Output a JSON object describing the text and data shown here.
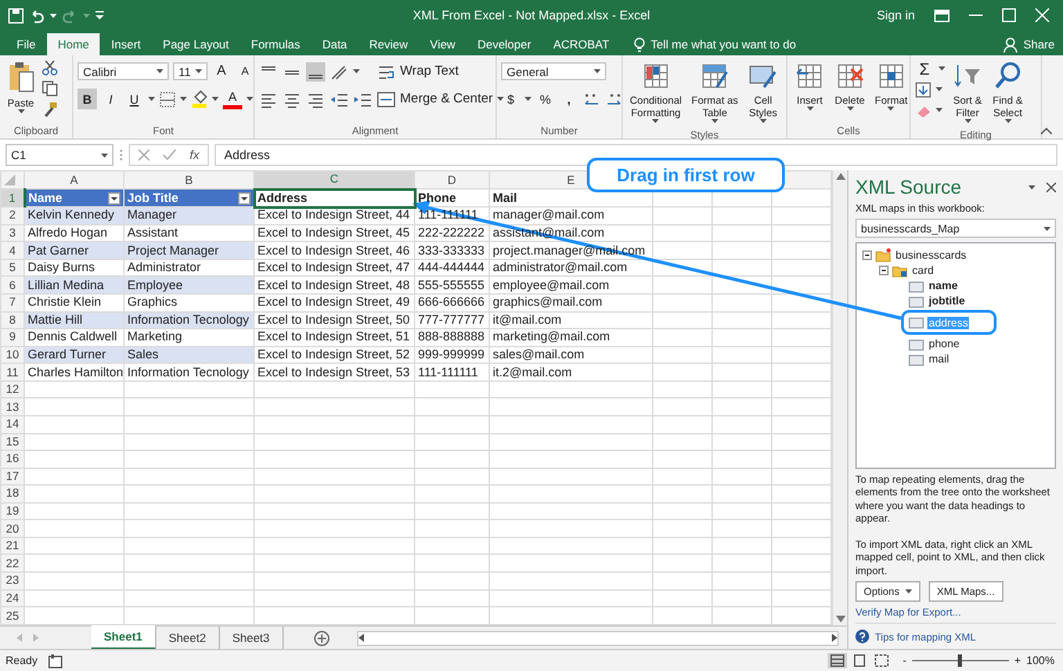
{
  "title_bar": {
    "title": "XML From Excel - Not Mapped.xlsx - Excel",
    "sign_in": "Sign in"
  },
  "tabs": [
    {
      "label": "File",
      "selected": false
    },
    {
      "label": "Home",
      "selected": true
    },
    {
      "label": "Insert",
      "selected": false
    },
    {
      "label": "Page Layout",
      "selected": false
    },
    {
      "label": "Formulas",
      "selected": false
    },
    {
      "label": "Data",
      "selected": false
    },
    {
      "label": "Review",
      "selected": false
    },
    {
      "label": "View",
      "selected": false
    },
    {
      "label": "Developer",
      "selected": false
    },
    {
      "label": "ACROBAT",
      "selected": false
    }
  ],
  "tell_me": "Tell me what you want to do",
  "share": "Share",
  "ribbon": {
    "clipboard": {
      "paste": "Paste",
      "label": "Clipboard"
    },
    "font": {
      "family": "Calibri",
      "size": "11",
      "grow": "A",
      "shrink": "A",
      "bold": {
        "text": "B",
        "on": true
      },
      "italic": {
        "text": "I",
        "on": false
      },
      "underline": {
        "text": "U",
        "on": false
      },
      "color_button": "A",
      "label": "Font"
    },
    "alignment": {
      "align_bottom": {
        "on": true
      },
      "wrap": "Wrap Text",
      "merge": "Merge & Center",
      "label": "Alignment"
    },
    "number": {
      "format": "General",
      "currency": "$",
      "percent": "%",
      "comma": ",",
      "label": "Number"
    },
    "styles": {
      "buttons": [
        {
          "lines": [
            "Conditional",
            "Formatting"
          ]
        },
        {
          "lines": [
            "Format as",
            "Table"
          ]
        },
        {
          "lines": [
            "Cell",
            "Styles"
          ]
        }
      ],
      "label": "Styles"
    },
    "cells": {
      "buttons": [
        "Insert",
        "Delete",
        "Format"
      ],
      "label": "Cells"
    },
    "editing": {
      "sum": "Σ",
      "sort": [
        "Sort &",
        "Filter"
      ],
      "find": [
        "Find &",
        "Select"
      ],
      "label": "Editing"
    }
  },
  "formula_bar": {
    "name_box": "C1",
    "fx": "fx",
    "content": "Address"
  },
  "sheet": {
    "columns": [
      {
        "letter": "A",
        "selected": false,
        "in_table": true
      },
      {
        "letter": "B",
        "selected": false,
        "in_table": true
      },
      {
        "letter": "C",
        "selected": true,
        "in_table": false
      },
      {
        "letter": "D",
        "selected": false,
        "in_table": false
      },
      {
        "letter": "E",
        "selected": false,
        "in_table": false
      }
    ],
    "rows": [
      {
        "number": "1",
        "kind": "header",
        "selected": true,
        "cells": [
          "Name",
          "Job Title",
          "Address",
          "Phone",
          "Mail"
        ]
      },
      {
        "number": "2",
        "kind": "data",
        "selected": false,
        "cells": [
          "Kelvin Kennedy",
          "Manager",
          "Excel to Indesign Street, 44",
          "111-111111",
          "manager@mail.com"
        ]
      },
      {
        "number": "3",
        "kind": "data",
        "selected": false,
        "cells": [
          "Alfredo Hogan",
          "Assistant",
          "Excel to Indesign Street, 45",
          "222-222222",
          "assistant@mail.com"
        ]
      },
      {
        "number": "4",
        "kind": "data",
        "selected": false,
        "cells": [
          "Pat Garner",
          "Project Manager",
          "Excel to Indesign Street, 46",
          "333-333333",
          "project.manager@mail.com"
        ]
      },
      {
        "number": "5",
        "kind": "data",
        "selected": false,
        "cells": [
          "Daisy Burns",
          "Administrator",
          "Excel to Indesign Street, 47",
          "444-444444",
          "administrator@mail.com"
        ]
      },
      {
        "number": "6",
        "kind": "data",
        "selected": false,
        "cells": [
          "Lillian Medina",
          "Employee",
          "Excel to Indesign Street, 48",
          "555-555555",
          "employee@mail.com"
        ]
      },
      {
        "number": "7",
        "kind": "data",
        "selected": false,
        "cells": [
          "Christie Klein",
          "Graphics",
          "Excel to Indesign Street, 49",
          "666-666666",
          "graphics@mail.com"
        ]
      },
      {
        "number": "8",
        "kind": "data",
        "selected": false,
        "cells": [
          "Mattie Hill",
          "Information Tecnology",
          "Excel to Indesign Street, 50",
          "777-777777",
          "it@mail.com"
        ]
      },
      {
        "number": "9",
        "kind": "data",
        "selected": false,
        "cells": [
          "Dennis Caldwell",
          "Marketing",
          "Excel to Indesign Street, 51",
          "888-888888",
          "marketing@mail.com"
        ]
      },
      {
        "number": "10",
        "kind": "data",
        "selected": false,
        "cells": [
          "Gerard Turner",
          "Sales",
          "Excel to Indesign Street, 52",
          "999-999999",
          "sales@mail.com"
        ]
      },
      {
        "number": "11",
        "kind": "data",
        "selected": false,
        "cells": [
          "Charles Hamilton",
          "Information Tecnology",
          "Excel to Indesign Street, 53",
          "111-111111",
          "it.2@mail.com"
        ]
      },
      {
        "number": "12",
        "kind": "data",
        "selected": false,
        "cells": []
      },
      {
        "number": "13",
        "kind": "data",
        "selected": false,
        "cells": []
      },
      {
        "number": "14",
        "kind": "data",
        "selected": false,
        "cells": []
      },
      {
        "number": "15",
        "kind": "data",
        "selected": false,
        "cells": []
      },
      {
        "number": "16",
        "kind": "data",
        "selected": false,
        "cells": []
      },
      {
        "number": "17",
        "kind": "data",
        "selected": false,
        "cells": []
      },
      {
        "number": "18",
        "kind": "data",
        "selected": false,
        "cells": []
      },
      {
        "number": "19",
        "kind": "data",
        "selected": false,
        "cells": []
      },
      {
        "number": "20",
        "kind": "data",
        "selected": false,
        "cells": []
      },
      {
        "number": "21",
        "kind": "data",
        "selected": false,
        "cells": []
      },
      {
        "number": "22",
        "kind": "data",
        "selected": false,
        "cells": []
      },
      {
        "number": "23",
        "kind": "data",
        "selected": false,
        "cells": []
      },
      {
        "number": "24",
        "kind": "data",
        "selected": false,
        "cells": []
      },
      {
        "number": "25",
        "kind": "data",
        "selected": false,
        "cells": []
      }
    ]
  },
  "sheet_tabs": [
    {
      "label": "Sheet1",
      "selected": true
    },
    {
      "label": "Sheet2",
      "selected": false
    },
    {
      "label": "Sheet3",
      "selected": false
    }
  ],
  "xml_source": {
    "title": "XML Source",
    "maps_label": "XML maps in this workbook:",
    "map": "businesscards_Map",
    "tree": [
      {
        "label": "businesscards",
        "kind": "root",
        "expanded": true,
        "mapped": false,
        "selected": false,
        "children": [
          {
            "label": "card",
            "kind": "repeating",
            "expanded": true,
            "mapped": false,
            "selected": false,
            "children": [
              {
                "label": "name",
                "kind": "element",
                "mapped": true,
                "selected": false
              },
              {
                "label": "jobtitle",
                "kind": "element",
                "mapped": true,
                "selected": false
              },
              {
                "label": "address",
                "kind": "element",
                "mapped": false,
                "selected": true
              },
              {
                "label": "phone",
                "kind": "element",
                "mapped": false,
                "selected": false
              },
              {
                "label": "mail",
                "kind": "element",
                "mapped": false,
                "selected": false
              }
            ]
          }
        ]
      }
    ],
    "help_map": "To map repeating elements, drag the elements from the tree onto the worksheet where you want the data headings to appear.",
    "help_import": "To import XML data, right click an XML mapped cell, point to XML, and then click import.",
    "options": "Options",
    "xml_maps": "XML Maps...",
    "verify": "Verify Map for Export...",
    "tips": "Tips for mapping XML"
  },
  "status_bar": {
    "status": "Ready",
    "views": [
      {
        "selected": true
      },
      {
        "selected": false
      },
      {
        "selected": false
      }
    ],
    "zoom_out": "-",
    "zoom_in": "+",
    "zoom": {
      "level": 0.5
    },
    "zoom_text": "100%"
  },
  "callout": {
    "text": "Drag in first row"
  }
}
